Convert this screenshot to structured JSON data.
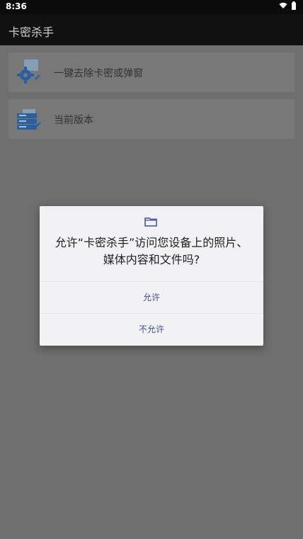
{
  "status": {
    "time": "8:36",
    "icons": [
      "wifi-icon",
      "battery-icon"
    ]
  },
  "app": {
    "title": "卡密杀手"
  },
  "menu": {
    "items": [
      {
        "label": "一键去除卡密或弹窗",
        "icon": "gear-icon"
      },
      {
        "label": "当前版本",
        "icon": "server-icon"
      }
    ]
  },
  "dialog": {
    "icon": "folder-icon",
    "message": "允许“卡密杀手”访问您设备上的照片、媒体内容和文件吗?",
    "allow_label": "允许",
    "deny_label": "不允许"
  },
  "colors": {
    "accent_text": "#40508a",
    "overlay": "#6f6f6f",
    "appbar": "#111111"
  }
}
